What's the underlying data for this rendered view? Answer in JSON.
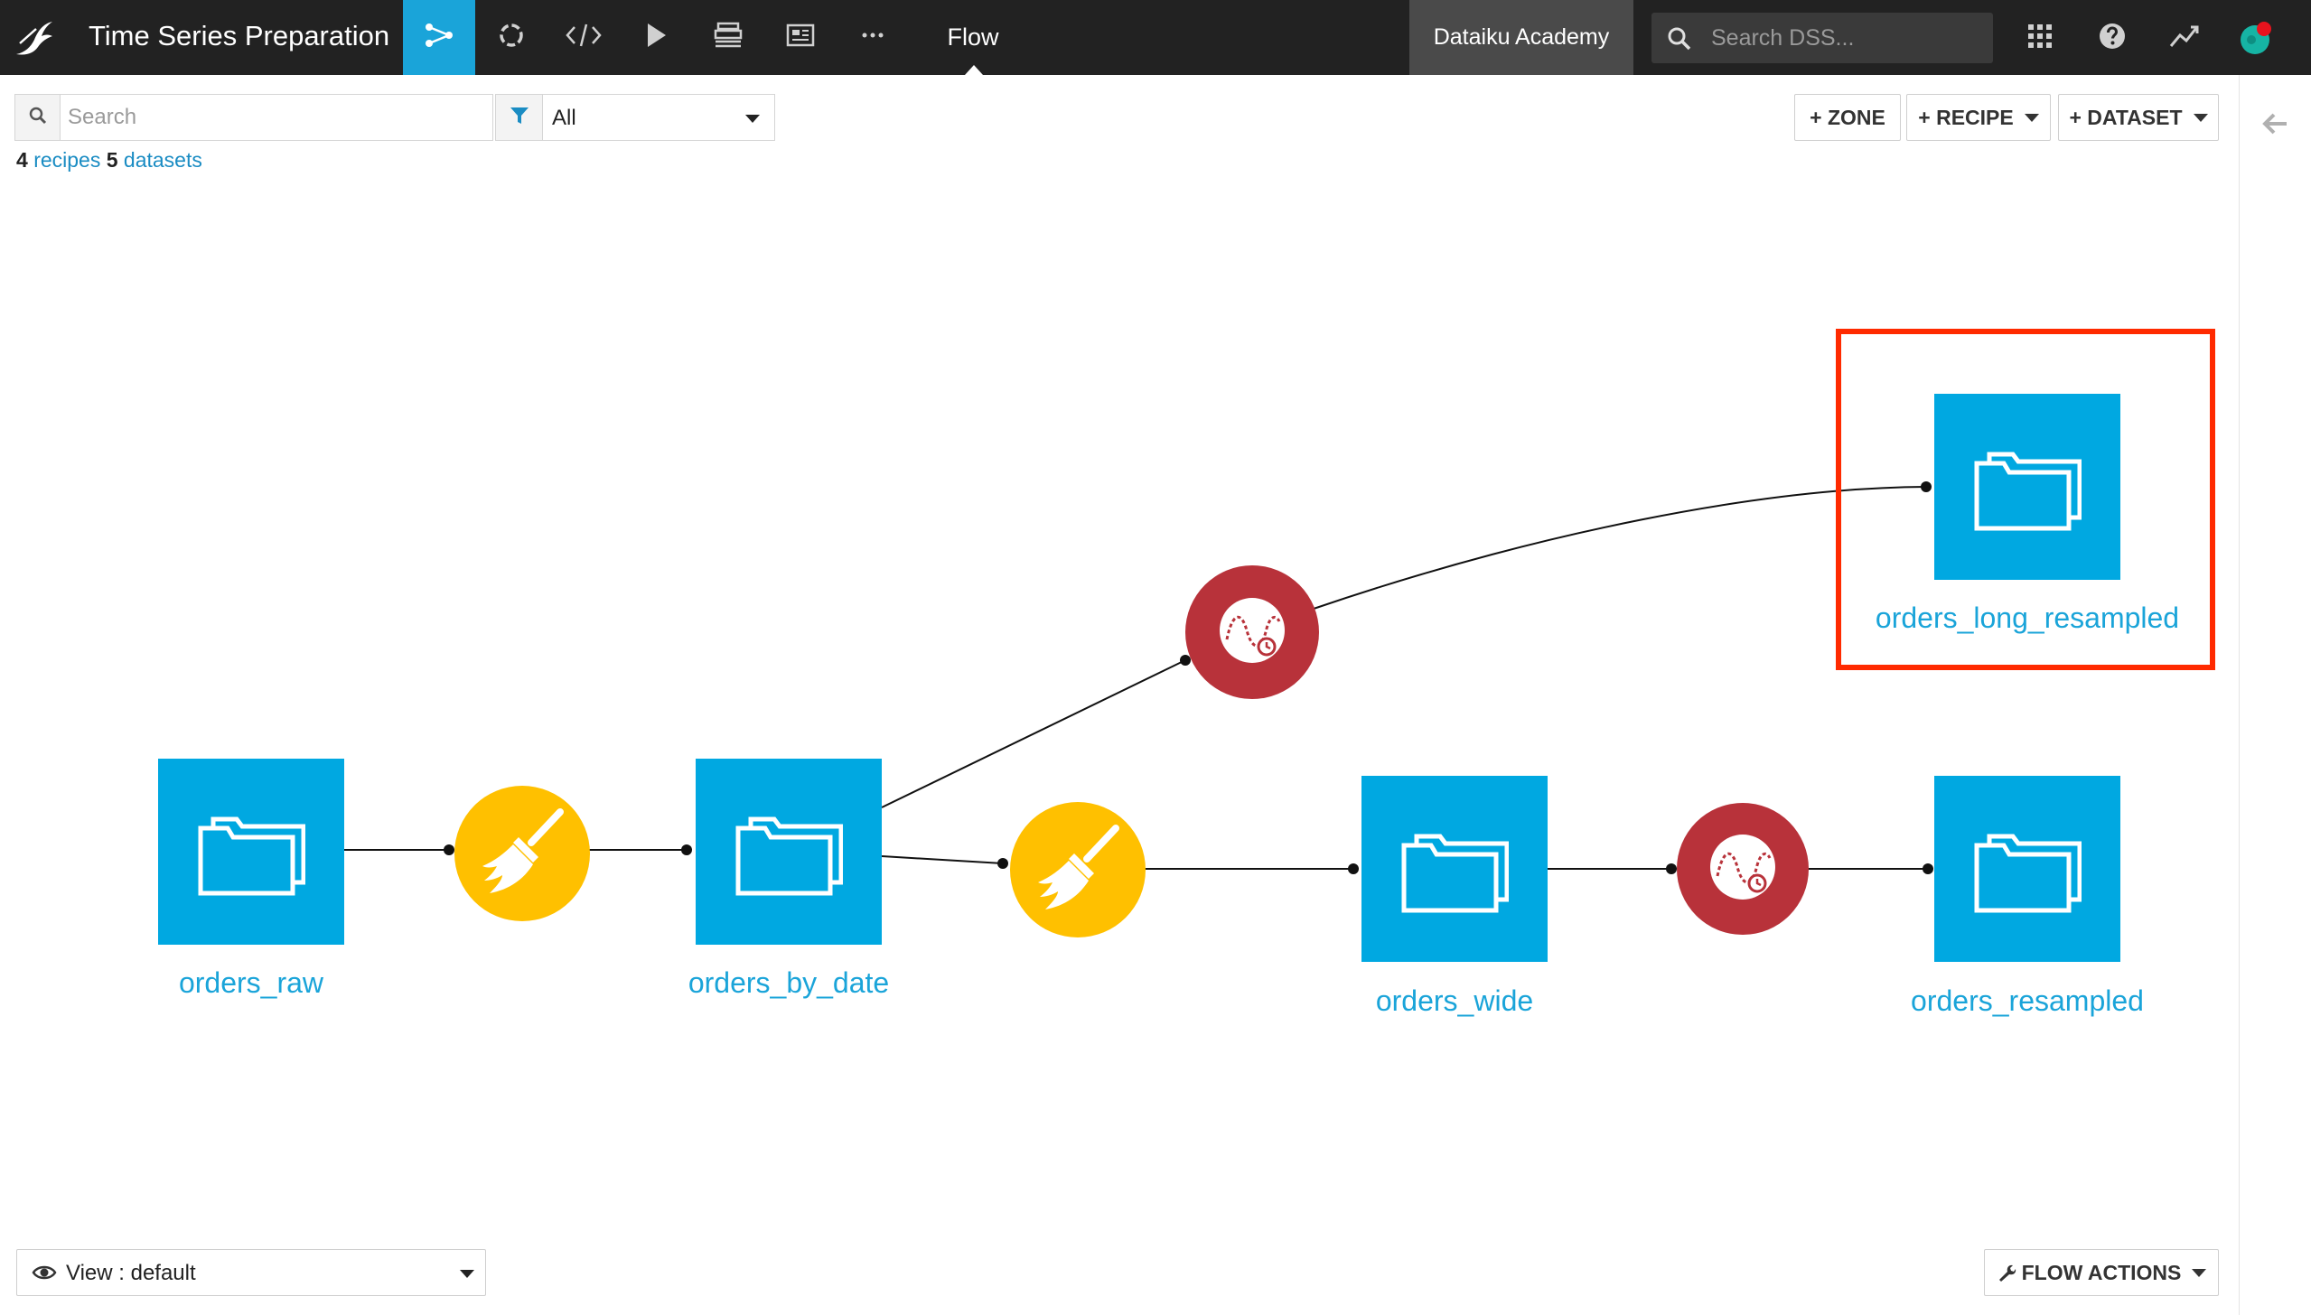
{
  "topbar": {
    "project_title": "Time Series Preparation",
    "flow_label": "Flow",
    "academy_label": "Dataiku Academy",
    "search_placeholder": "Search DSS...",
    "icons": [
      "flow-icon",
      "jobs-icon",
      "code-icon",
      "run-icon",
      "datasets-icon",
      "dashboard-icon",
      "more-icon"
    ],
    "right_icons": [
      "apps-grid-icon",
      "help-icon",
      "activity-icon",
      "user-avatar"
    ],
    "accent_color": "#1aa4d9",
    "notification_color": "#e8131d"
  },
  "toolbar": {
    "search_placeholder": "Search",
    "filter_value": "All",
    "counts": {
      "recipes_count": "4",
      "recipes_label": "recipes",
      "datasets_count": "5",
      "datasets_label": "datasets"
    },
    "buttons": {
      "zone": "+ ZONE",
      "recipe": "+ RECIPE",
      "dataset": "+ DATASET"
    }
  },
  "flow": {
    "datasets": [
      {
        "id": "orders_raw",
        "label": "orders_raw"
      },
      {
        "id": "orders_by_date",
        "label": "orders_by_date"
      },
      {
        "id": "orders_wide",
        "label": "orders_wide"
      },
      {
        "id": "orders_resampled",
        "label": "orders_resampled"
      },
      {
        "id": "orders_long_resampled",
        "label": "orders_long_resampled",
        "highlighted": true
      }
    ],
    "recipes": [
      {
        "id": "prepare_1",
        "type": "prepare",
        "icon": "broom-icon",
        "color": "#ffc000"
      },
      {
        "id": "prepare_2",
        "type": "prepare",
        "icon": "broom-icon",
        "color": "#ffc000"
      },
      {
        "id": "resample_1",
        "type": "time-series-resampling",
        "icon": "time-series-icon",
        "color": "#b8323a"
      },
      {
        "id": "resample_2",
        "type": "time-series-resampling",
        "icon": "time-series-icon",
        "color": "#b8323a"
      }
    ],
    "dataset_color": "#00a8e1",
    "highlight_color": "#ff2a00"
  },
  "bottom": {
    "view_label": "View : default",
    "flow_actions_label": "FLOW ACTIONS"
  }
}
